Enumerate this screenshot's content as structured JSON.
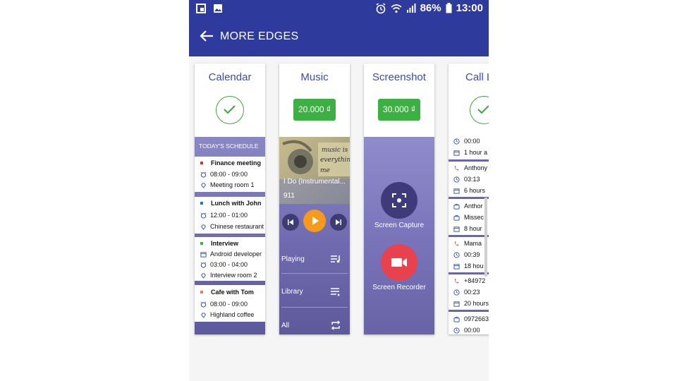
{
  "status_bar": {
    "battery": "86%",
    "time": "13:00"
  },
  "app_bar": {
    "title": "MORE EDGES"
  },
  "cards": {
    "calendar": {
      "title": "Calendar",
      "header": "TODAY'S SCHEDULE",
      "events": [
        {
          "title": "Finance meeting",
          "color": "#d32f2f",
          "time": "08:00 - 09:00",
          "place": "Meeting room 1"
        },
        {
          "title": "Lunch with John",
          "color": "#1e73d8",
          "time": "12:00 - 01:00",
          "place": "Chinese restaurant"
        },
        {
          "title": "Interview",
          "color": "#3cb043",
          "note": "Android developer",
          "time": "03:00 - 04:00",
          "place": "Interview room 2"
        },
        {
          "title": "Cafe with Tom",
          "color": "#f27a5a",
          "time": "08:00 - 09:00",
          "place": "Highland coffee"
        }
      ]
    },
    "music": {
      "title": "Music",
      "price": "20.000 ₫",
      "album_text": [
        "music is",
        "everything",
        "me"
      ],
      "song": "I Do (Instrumental...",
      "artist": "911",
      "menu": [
        {
          "label": "Playing",
          "icon": "queue-music-icon"
        },
        {
          "label": "Library",
          "icon": "library-list-icon"
        },
        {
          "label": "All",
          "icon": "repeat-icon"
        }
      ]
    },
    "screenshot": {
      "title": "Screenshot",
      "price": "30.000 ₫",
      "capture_label": "Screen Capture",
      "recorder_label": "Screen Recorder",
      "capture_color": "#3f3a7a",
      "recorder_color": "#e8424f"
    },
    "call_log": {
      "title": "Call L",
      "groups": [
        {
          "rows": [
            {
              "icon": "clock-icon",
              "text": "00:00"
            },
            {
              "icon": "calendar-icon",
              "text": "1 hour a"
            }
          ]
        },
        {
          "rows": [
            {
              "icon": "missed-call-icon",
              "text": "Anthony"
            },
            {
              "icon": "clock-icon",
              "text": "03:13"
            },
            {
              "icon": "calendar-icon",
              "text": "6 hours"
            }
          ]
        },
        {
          "rows": [
            {
              "icon": "phone-icon",
              "text": "Anthor"
            },
            {
              "icon": "phone-icon",
              "text": "Missec"
            },
            {
              "icon": "calendar-icon",
              "text": "8 hour"
            }
          ]
        },
        {
          "rows": [
            {
              "icon": "missed-call-icon",
              "text": "Mama"
            },
            {
              "icon": "clock-icon",
              "text": "00:39"
            },
            {
              "icon": "calendar-icon",
              "text": "18 hou"
            }
          ]
        },
        {
          "rows": [
            {
              "icon": "missed-call-icon",
              "text": "+84972"
            },
            {
              "icon": "clock-icon",
              "text": "00:23"
            },
            {
              "icon": "calendar-icon",
              "text": "20 hours"
            }
          ]
        },
        {
          "rows": [
            {
              "icon": "phone-icon",
              "text": "0972663"
            },
            {
              "icon": "clock-icon",
              "text": "00:00"
            }
          ]
        }
      ]
    }
  }
}
